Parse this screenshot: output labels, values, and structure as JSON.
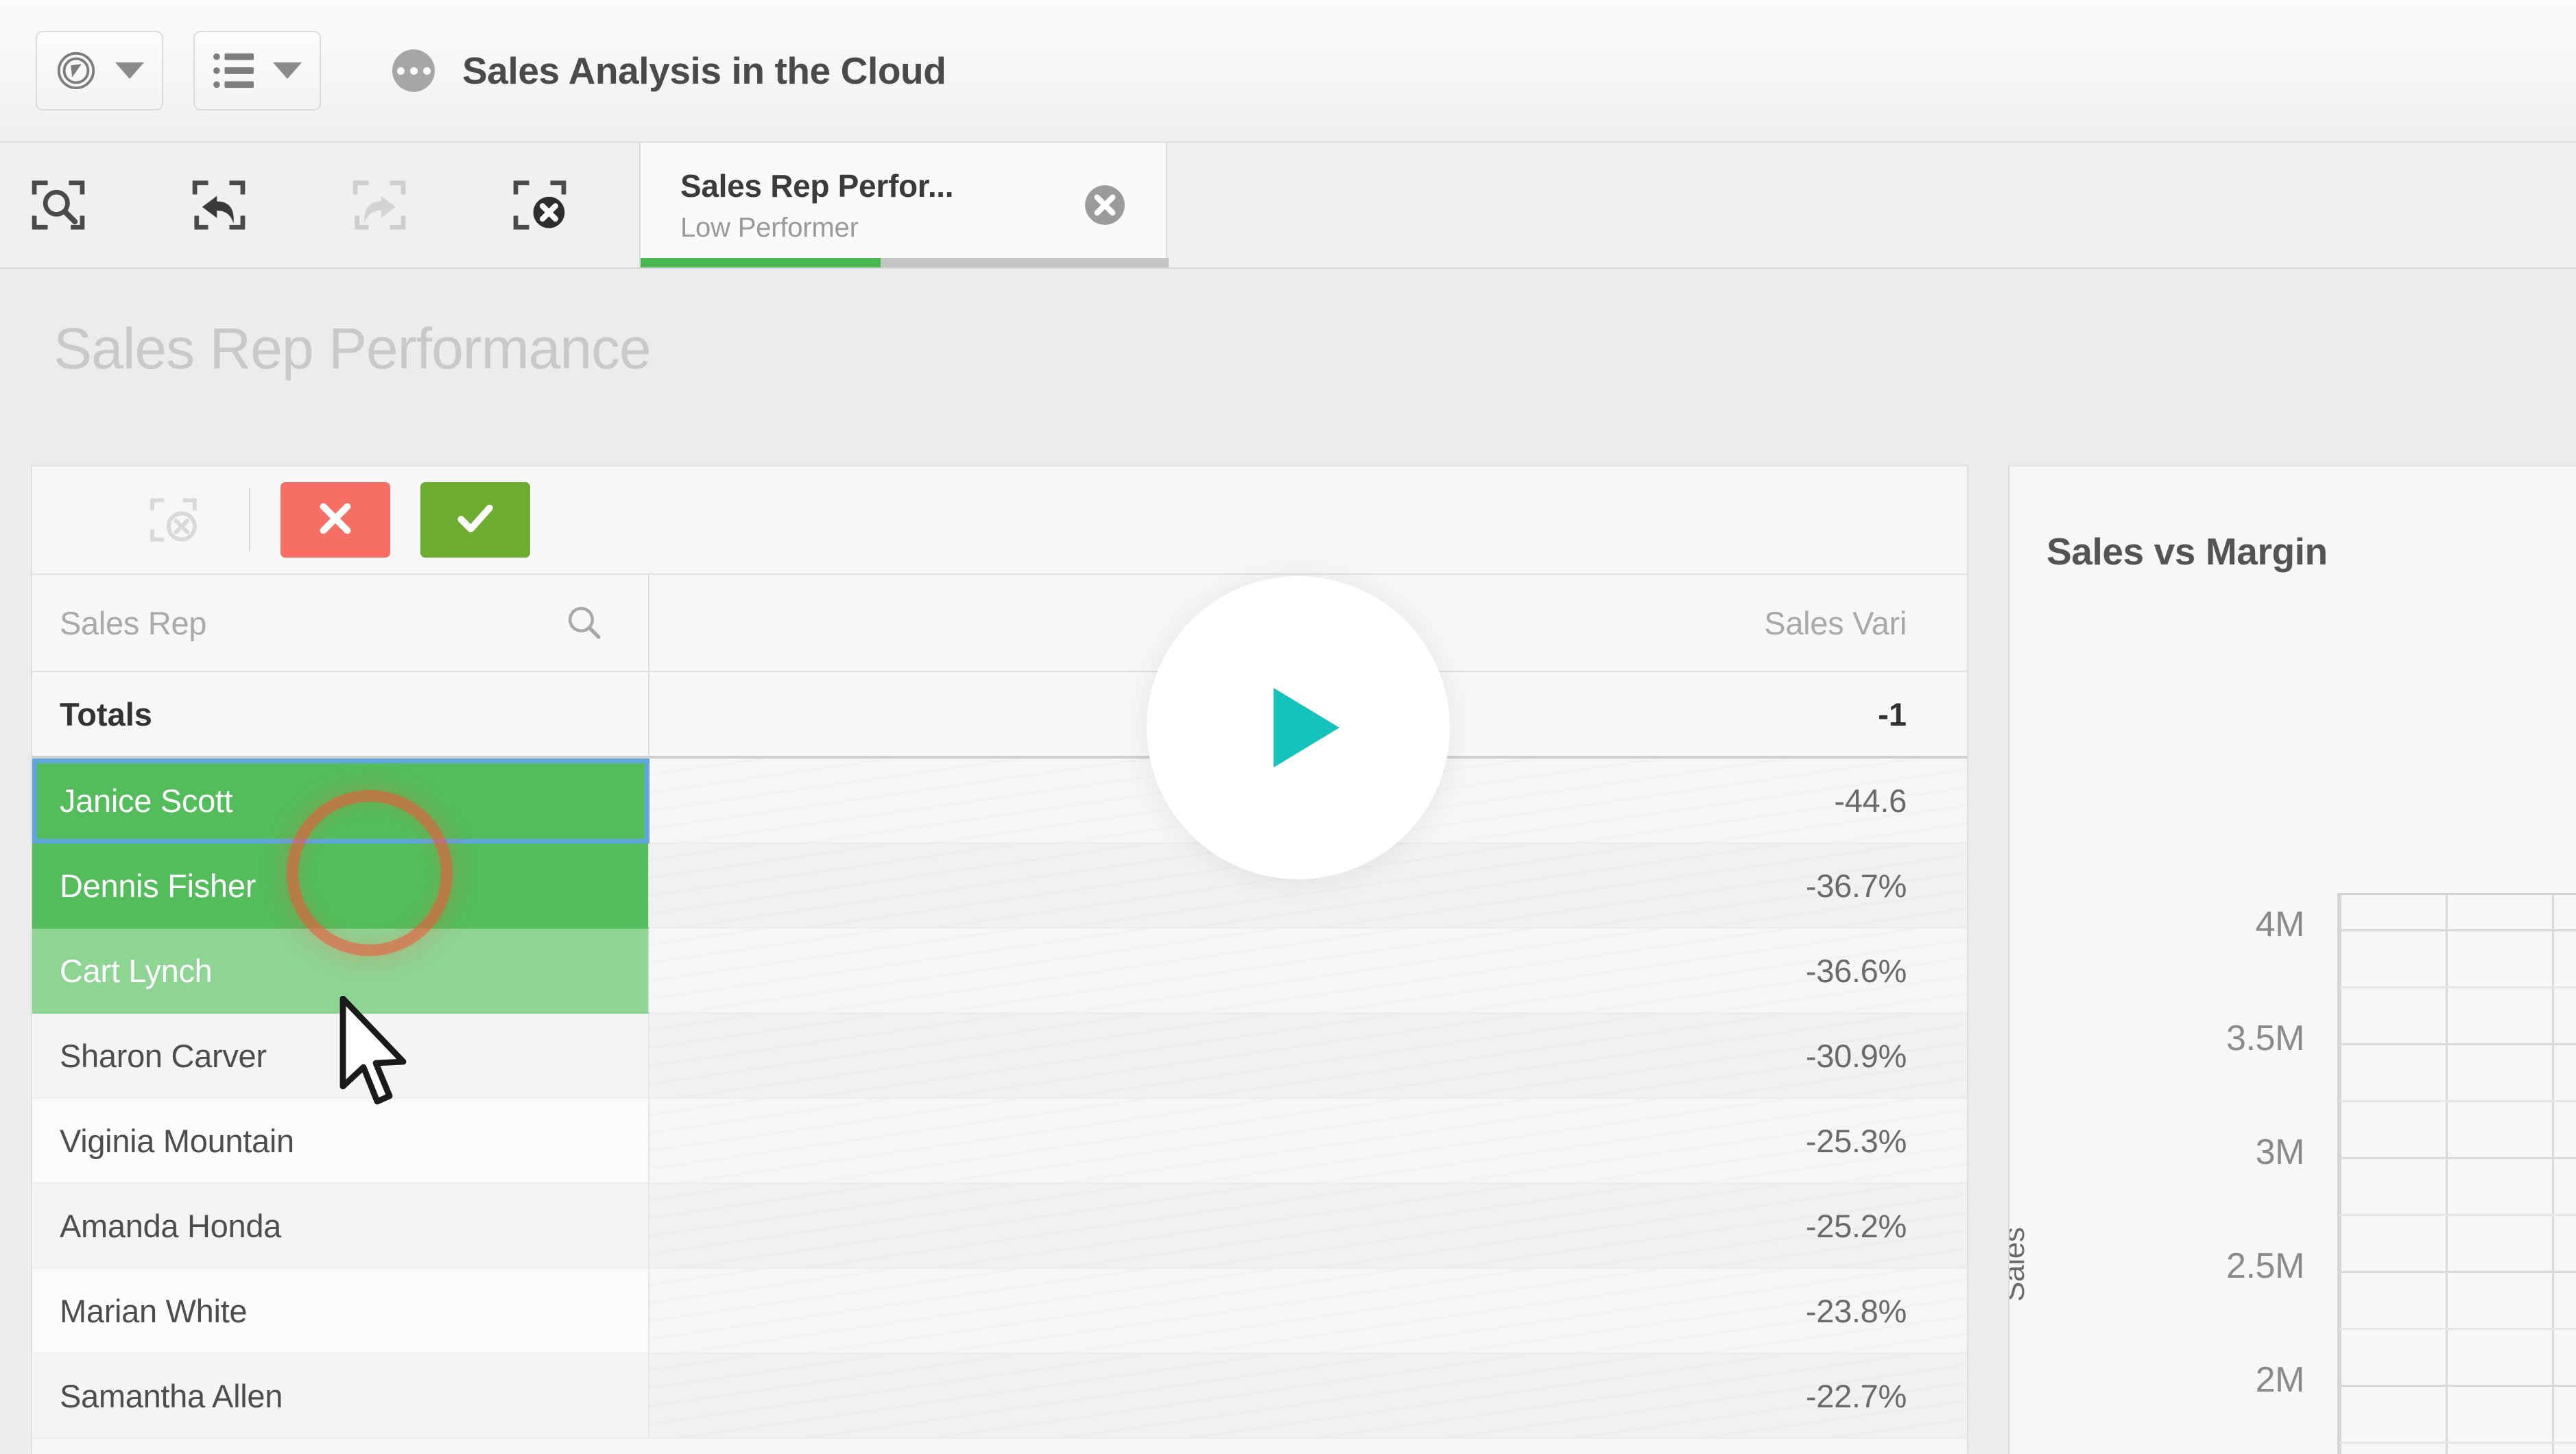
{
  "header": {
    "nav_icon": "compass-icon",
    "nav_caret": "chevron-down-icon",
    "sheets_icon": "list-icon",
    "sheets_caret": "chevron-down-icon",
    "sheet_indicator_icon": "more-dots-icon",
    "app_title": "Sales Analysis in the Cloud"
  },
  "selection_toolbar": {
    "icons": [
      {
        "name": "smart-search-icon",
        "label": "Smart search",
        "disabled": false
      },
      {
        "name": "step-back-icon",
        "label": "Step back",
        "disabled": false
      },
      {
        "name": "step-forward-icon",
        "label": "Step forward",
        "disabled": true
      },
      {
        "name": "clear-all-selections-icon",
        "label": "Clear all selections",
        "disabled": false
      }
    ],
    "tab": {
      "title": "Sales Rep Perfor...",
      "subtitle": "Low Performer",
      "close_icon": "close-circle-icon",
      "bar_color": "#4cb752"
    }
  },
  "sheet": {
    "title": "Sales Rep Performance"
  },
  "table": {
    "toolbar": {
      "clear_icon": "clear-selection-icon",
      "cancel_label": "×",
      "cancel_icon": "cancel-x-icon",
      "cancel_color": "#f76e64",
      "confirm_label": "✓",
      "confirm_icon": "confirm-check-icon",
      "confirm_color": "#6dad2f"
    },
    "search": {
      "placeholder": "Sales Rep",
      "value": "",
      "icon": "search-icon"
    },
    "columns": [
      {
        "key": "dim",
        "label": "Sales Rep"
      },
      {
        "key": "variance",
        "label": "Sales Vari",
        "sort": "ascending",
        "sort_icon": "sort-ascending-icon"
      }
    ],
    "totals": {
      "label": "Totals",
      "value": "-1"
    },
    "rows": [
      {
        "name": "Janice Scott",
        "variance": "-44.6",
        "state": "focused"
      },
      {
        "name": "Dennis Fisher",
        "variance": "-36.7%",
        "state": "selected"
      },
      {
        "name": "Cart Lynch",
        "variance": "-36.6%",
        "state": "alternative"
      },
      {
        "name": "Sharon Carver",
        "variance": "-30.9%",
        "state": "none"
      },
      {
        "name": "Viginia Mountain",
        "variance": "-25.3%",
        "state": "none"
      },
      {
        "name": "Amanda Honda",
        "variance": "-25.2%",
        "state": "none"
      },
      {
        "name": "Marian White",
        "variance": "-23.8%",
        "state": "none"
      },
      {
        "name": "Samantha Allen",
        "variance": "-22.7%",
        "state": "none"
      }
    ]
  },
  "play_overlay": {
    "icon": "play-icon",
    "color": "#15c3bd"
  },
  "cursor": {
    "icon": "mouse-pointer-icon"
  },
  "click_indicator": {
    "color": "#f4573c"
  },
  "chart_data": {
    "type": "scatter",
    "title": "Sales vs Margin",
    "xlabel": "",
    "ylabel": "Sales",
    "yticks": [
      "4M",
      "3.5M",
      "3M",
      "2.5M",
      "2M"
    ],
    "yvalues": [
      4000000,
      3500000,
      3000000,
      2500000,
      2000000
    ],
    "ylim": [
      2000000,
      4000000
    ],
    "grid": true,
    "legend": "none",
    "series": []
  }
}
